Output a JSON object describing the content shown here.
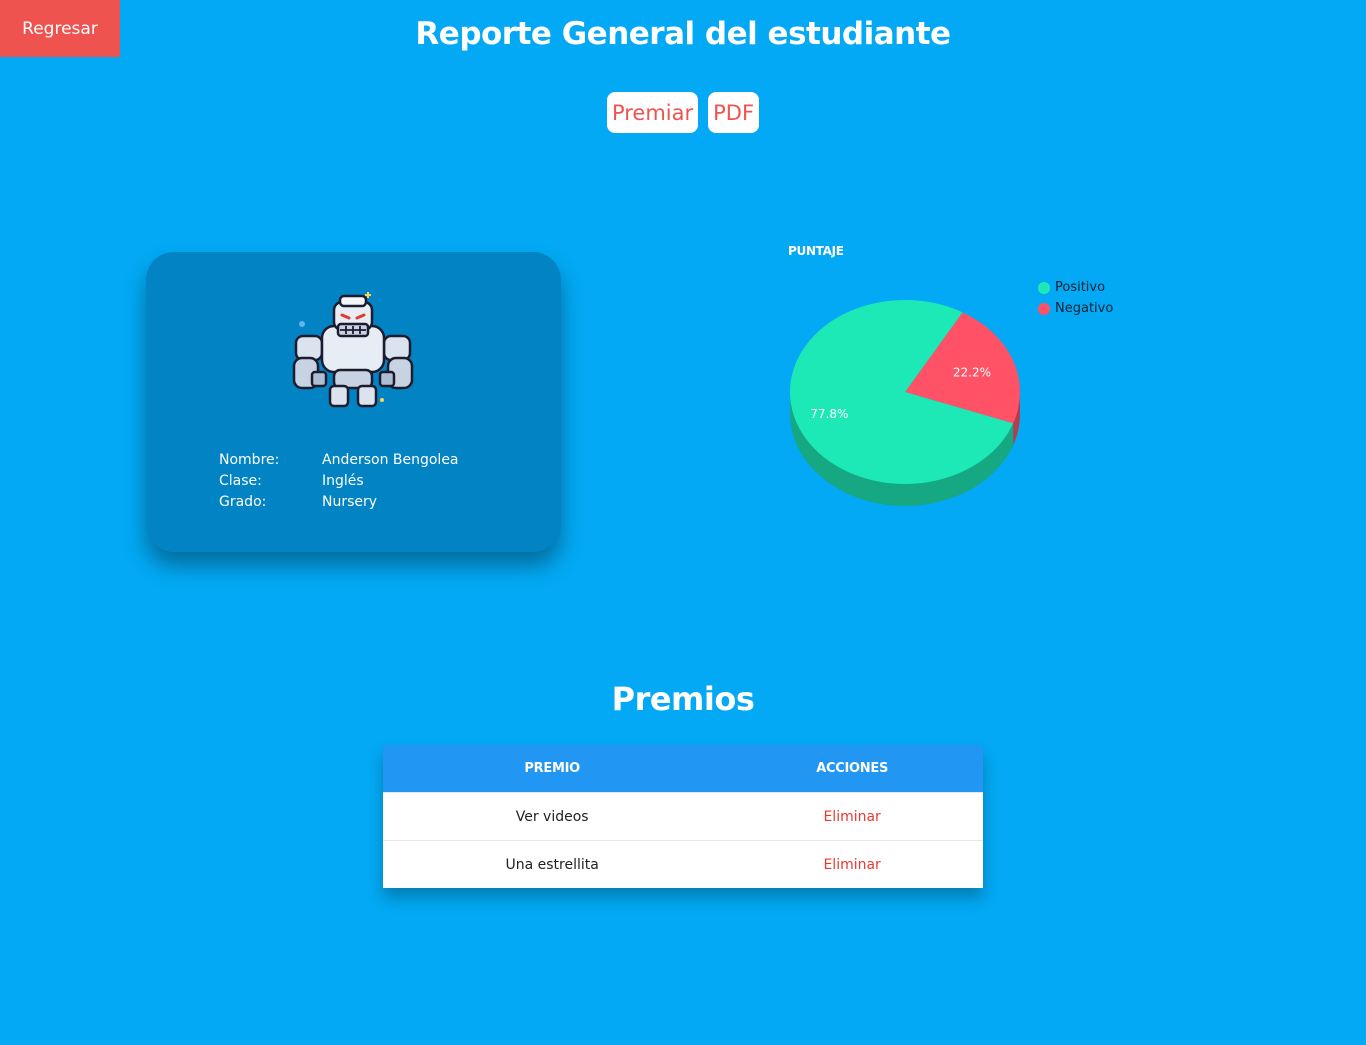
{
  "nav": {
    "back_label": "Regresar"
  },
  "header": {
    "title": "Reporte General del estudiante"
  },
  "actions": {
    "award_label": "Premiar",
    "pdf_label": "PDF"
  },
  "student": {
    "avatar_icon": "robot-golem-icon",
    "fields": [
      {
        "label": "Nombre:",
        "value": "Anderson Bengolea"
      },
      {
        "label": "Clase:",
        "value": "Inglés"
      },
      {
        "label": "Grado:",
        "value": "Nursery"
      }
    ]
  },
  "chart_data": {
    "type": "pie",
    "title": "PUNTAJE",
    "legend_position": "top-right",
    "slices": [
      {
        "label": "Positivo",
        "value": 77.8,
        "color": "#1de9b6"
      },
      {
        "label": "Negativo",
        "value": 22.2,
        "color": "#ff5266"
      }
    ],
    "data_labels": [
      "77.8%",
      "22.2%"
    ]
  },
  "prizes": {
    "title": "Premios",
    "columns": [
      "PREMIO",
      "ACCIONES"
    ],
    "rows": [
      {
        "prize": "Ver videos",
        "action": "Eliminar"
      },
      {
        "prize": "Una estrellita",
        "action": "Eliminar"
      }
    ]
  }
}
